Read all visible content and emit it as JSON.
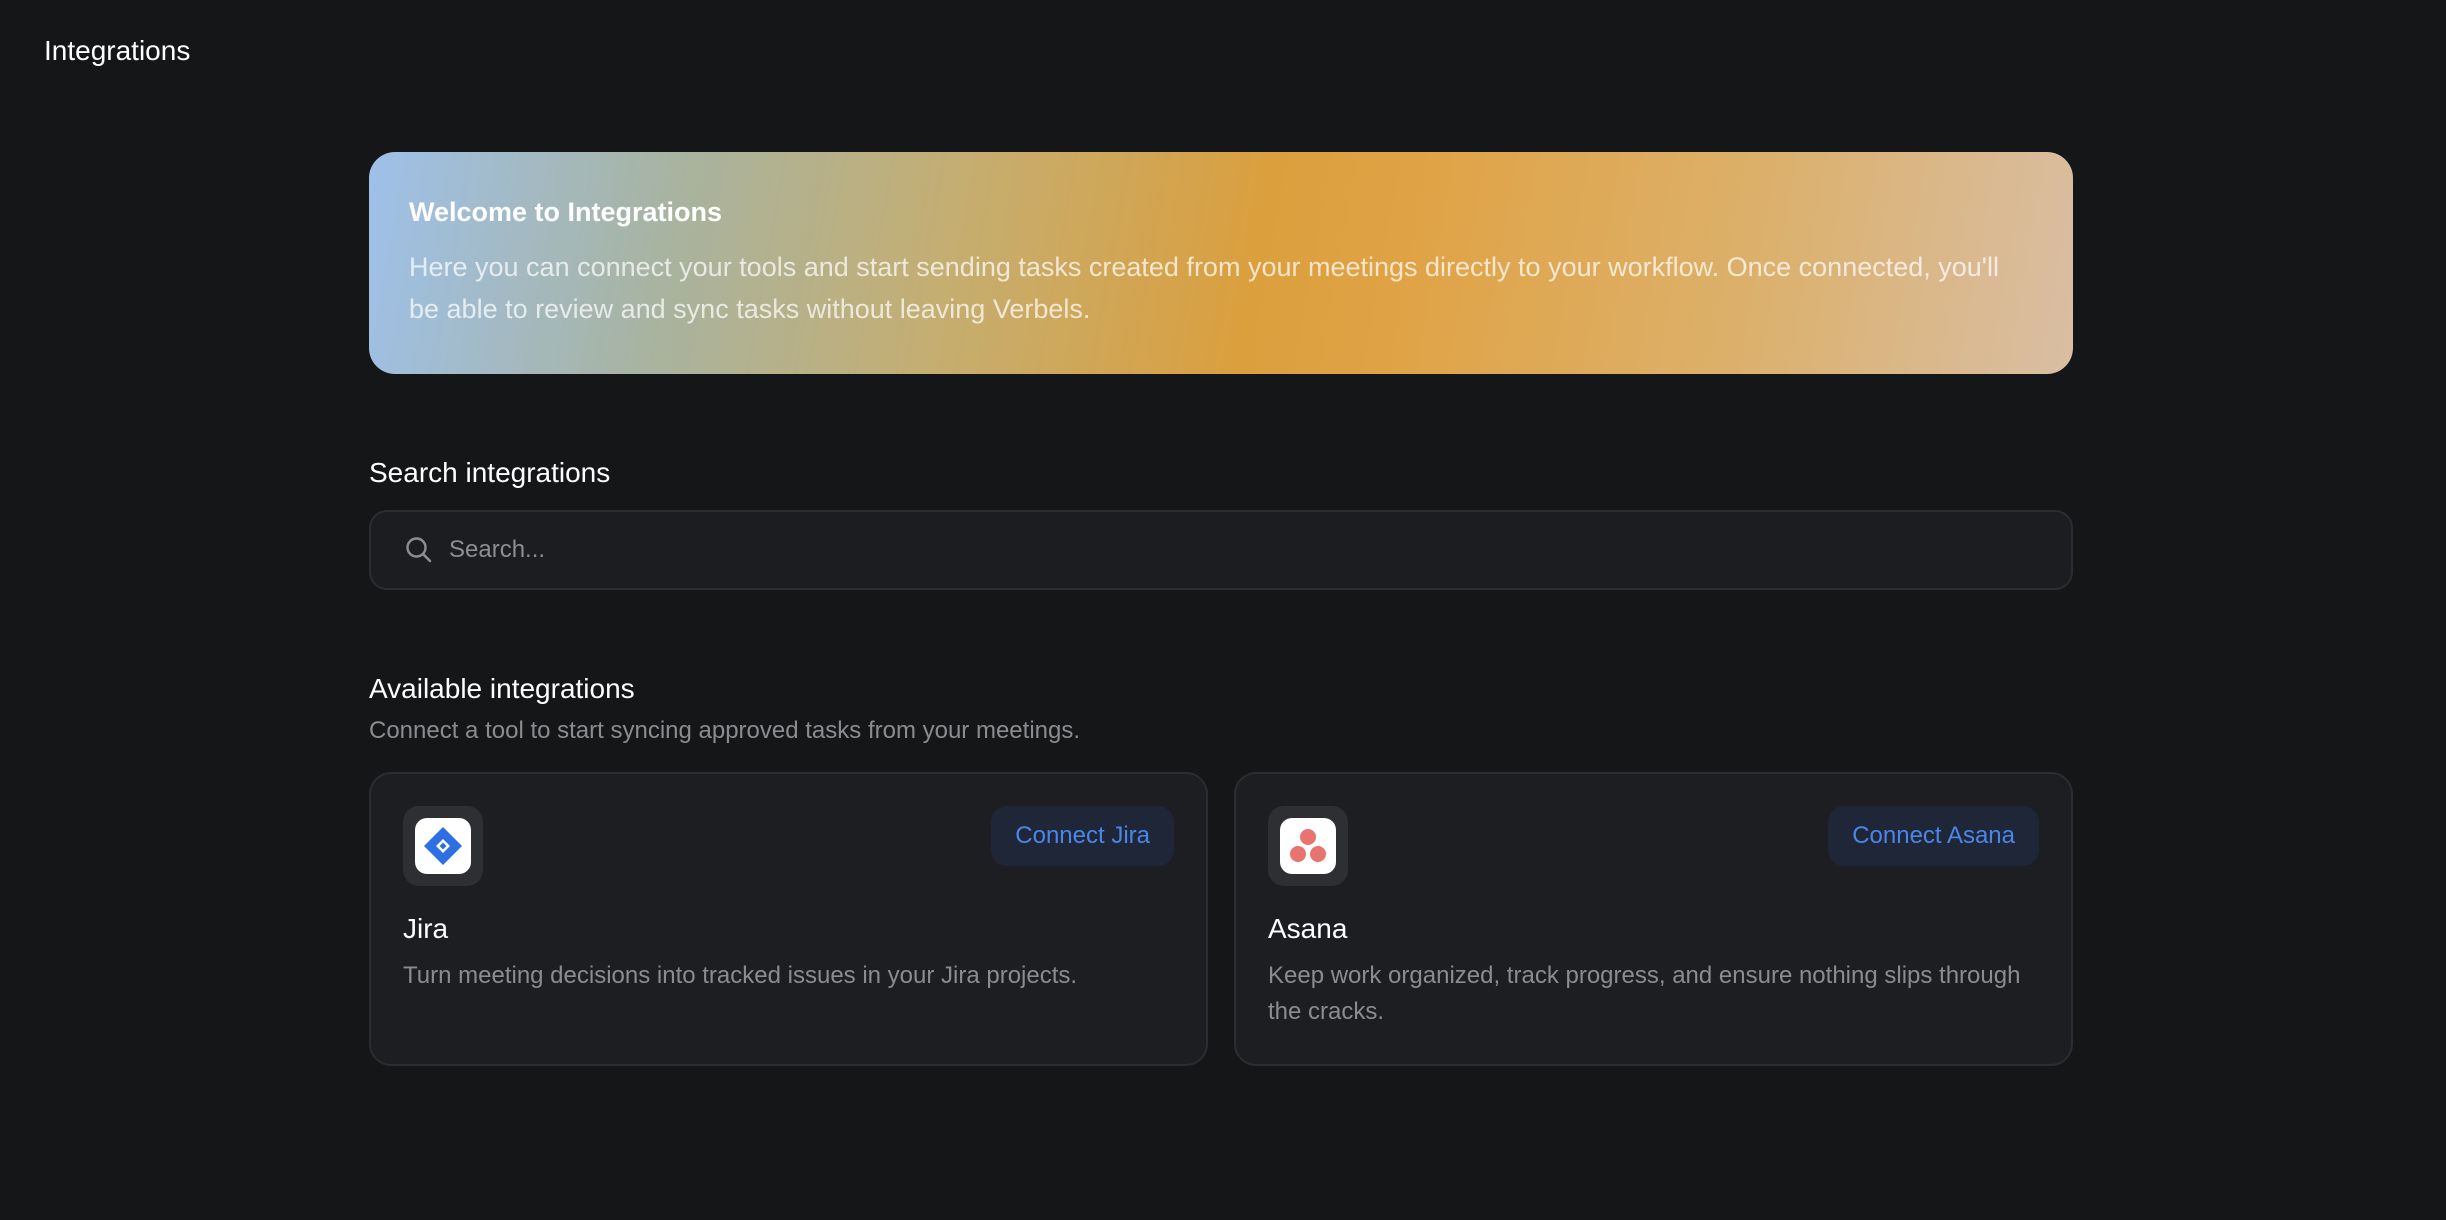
{
  "header": {
    "title": "Integrations"
  },
  "banner": {
    "title": "Welcome to Integrations",
    "text": "Here you can connect your tools and start sending tasks created from your meetings directly to your workflow. Once connected, you'll be able to review and sync tasks without leaving Verbels."
  },
  "search": {
    "label": "Search integrations",
    "placeholder": "Search...",
    "value": "",
    "icon": "search-icon"
  },
  "available": {
    "title": "Available integrations",
    "subtitle": "Connect a tool to start syncing approved tasks from your meetings."
  },
  "integrations": [
    {
      "name": "Jira",
      "description": "Turn meeting decisions into tracked issues in your Jira projects.",
      "button_label": "Connect Jira",
      "icon": "jira-logo-icon",
      "brand_color": "#2f6fe4"
    },
    {
      "name": "Asana",
      "description": "Keep work organized, track progress, and ensure nothing slips through the cracks.",
      "button_label": "Connect Asana",
      "icon": "asana-logo-icon",
      "brand_color": "#e8746f"
    }
  ],
  "colors": {
    "background": "#151618",
    "card": "#1d1e21",
    "accent": "#4a86e8"
  }
}
